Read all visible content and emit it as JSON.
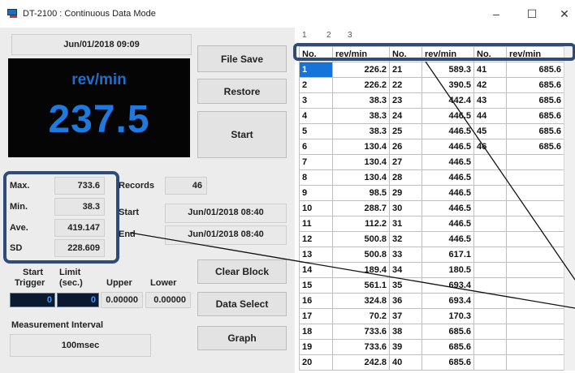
{
  "window": {
    "title": "DT-2100 : Continuous Data Mode",
    "min": "–",
    "max": "☐",
    "close": "✕"
  },
  "icons": {
    "app": "app-icon",
    "min": "minimize-icon",
    "max": "maximize-icon",
    "close": "close-icon"
  },
  "datetime": "Jun/01/2018 09:09",
  "display": {
    "unit": "rev/min",
    "value": "237.5"
  },
  "buttons": {
    "file_save": "File Save",
    "restore": "Restore",
    "start": "Start",
    "clear_block": "Clear Block",
    "data_select": "Data Select",
    "graph": "Graph"
  },
  "stats": {
    "max_label": "Max.",
    "max": "733.6",
    "min_label": "Min.",
    "min": "38.3",
    "ave_label": "Ave.",
    "ave": "419.147",
    "sd_label": "SD",
    "sd": "228.609"
  },
  "records": {
    "label": "Records",
    "value": "46"
  },
  "times": {
    "start_label": "Start",
    "start": "Jun/01/2018 08:40",
    "end_label": "End",
    "end": "Jun/01/2018 08:40"
  },
  "trigger": {
    "start_label": "Start",
    "trigger_label": "Trigger",
    "limit_label": "Limit",
    "sec_label": "(sec.)",
    "upper_label": "Upper",
    "lower_label": "Lower",
    "start_value": "0",
    "limit_value": "0",
    "upper": "0.00000",
    "lower": "0.00000"
  },
  "interval": {
    "label": "Measurement Interval",
    "value": "100msec"
  },
  "tabs": [
    "1",
    "2",
    "3"
  ],
  "table": {
    "headers": [
      "No.",
      "rev/min",
      "No.",
      "rev/min",
      "No.",
      "rev/min"
    ],
    "rows": [
      [
        "1",
        "226.2",
        "21",
        "589.3",
        "41",
        "685.6"
      ],
      [
        "2",
        "226.2",
        "22",
        "390.5",
        "42",
        "685.6"
      ],
      [
        "3",
        "38.3",
        "23",
        "442.4",
        "43",
        "685.6"
      ],
      [
        "4",
        "38.3",
        "24",
        "446.5",
        "44",
        "685.6"
      ],
      [
        "5",
        "38.3",
        "25",
        "446.5",
        "45",
        "685.6"
      ],
      [
        "6",
        "130.4",
        "26",
        "446.5",
        "46",
        "685.6"
      ],
      [
        "7",
        "130.4",
        "27",
        "446.5",
        "",
        ""
      ],
      [
        "8",
        "130.4",
        "28",
        "446.5",
        "",
        ""
      ],
      [
        "9",
        "98.5",
        "29",
        "446.5",
        "",
        ""
      ],
      [
        "10",
        "288.7",
        "30",
        "446.5",
        "",
        ""
      ],
      [
        "11",
        "112.2",
        "31",
        "446.5",
        "",
        ""
      ],
      [
        "12",
        "500.8",
        "32",
        "446.5",
        "",
        ""
      ],
      [
        "13",
        "500.8",
        "33",
        "617.1",
        "",
        ""
      ],
      [
        "14",
        "189.4",
        "34",
        "180.5",
        "",
        ""
      ],
      [
        "15",
        "561.1",
        "35",
        "693.4",
        "",
        ""
      ],
      [
        "16",
        "324.8",
        "36",
        "693.4",
        "",
        ""
      ],
      [
        "17",
        "70.2",
        "37",
        "170.3",
        "",
        ""
      ],
      [
        "18",
        "733.6",
        "38",
        "685.6",
        "",
        ""
      ],
      [
        "19",
        "733.6",
        "39",
        "685.6",
        "",
        ""
      ],
      [
        "20",
        "242.8",
        "40",
        "685.6",
        "",
        ""
      ]
    ]
  },
  "colors": {
    "lcd_text": "#1f7ae0",
    "lcd_bg": "#050505",
    "highlight": "#2f4b78",
    "selected_row": "#1673d9"
  }
}
